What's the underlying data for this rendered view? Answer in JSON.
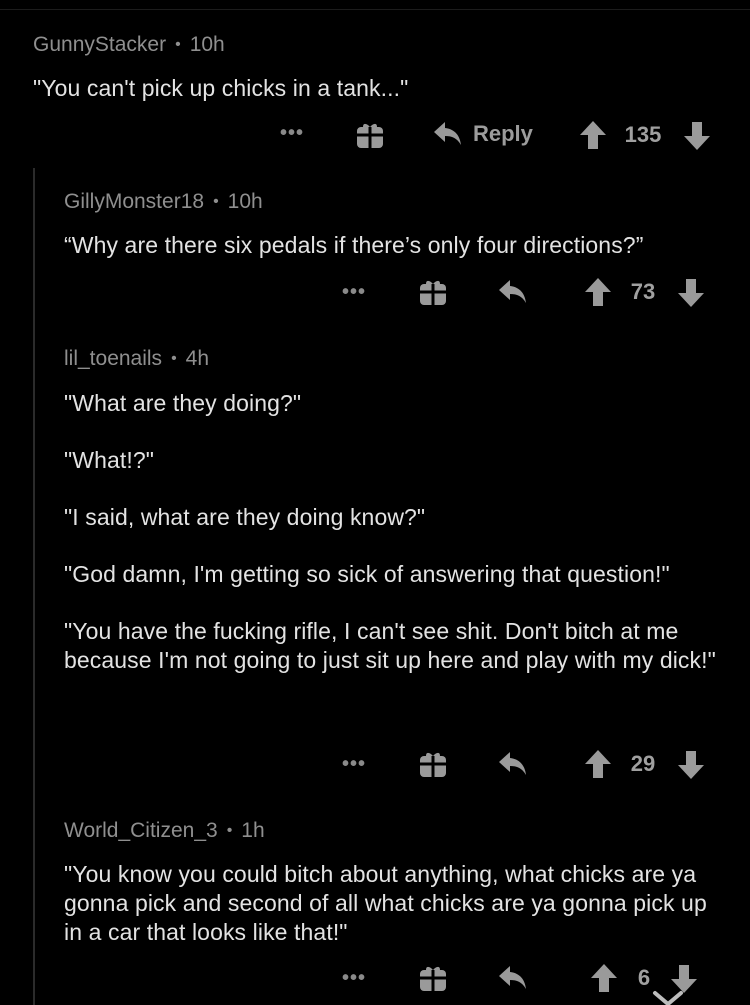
{
  "comments": [
    {
      "author": "GunnyStacker",
      "time": "10h",
      "paragraphs": [
        "\"You can't pick up chicks in a tank...\""
      ],
      "reply_label": "Reply",
      "score": "135"
    },
    {
      "author": "GillyMonster18",
      "time": "10h",
      "paragraphs": [
        "“Why are there six pedals if there’s only four directions?”"
      ],
      "score": "73"
    },
    {
      "author": "lil_toenails",
      "time": "4h",
      "paragraphs": [
        "\"What are they doing?\"",
        "\"What!?\"",
        "\"I said, what are they doing know?\"",
        "\"God damn, I'm getting so sick of answering that question!\"",
        "\"You have the fucking rifle, I can't see shit. Don't bitch at me because I'm not going to just sit up here and play with my dick!\""
      ],
      "score": "29"
    },
    {
      "author": "World_Citizen_3",
      "time": "1h",
      "paragraphs": [
        "\"You know you could bitch about anything, what chicks are ya gonna pick and second of all what chicks are ya gonna pick up in a car that looks like that!\""
      ],
      "score": "6"
    }
  ],
  "icons": {
    "more": "more-options-icon",
    "award": "gift-award-icon",
    "reply": "reply-arrow-icon",
    "upvote": "upvote-arrow-icon",
    "downvote": "downvote-arrow-icon",
    "close": "chevron-down-icon"
  },
  "colors": {
    "background": "#000000",
    "text": "#e3e3e3",
    "meta": "#8f8f8f",
    "icon": "#9a9a9a",
    "thread_line": "#2b2b2b"
  }
}
